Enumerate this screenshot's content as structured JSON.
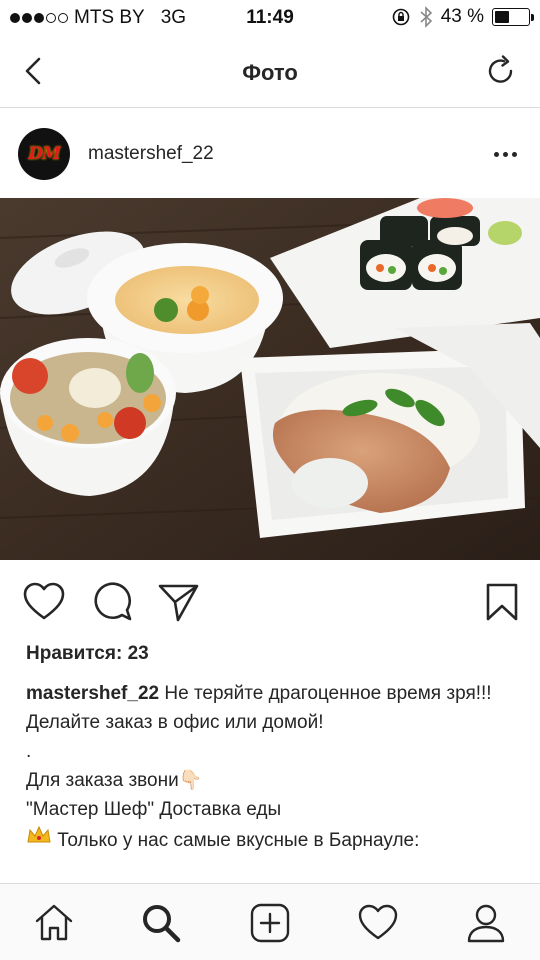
{
  "status_bar": {
    "carrier": "MTS BY",
    "network": "3G",
    "time": "11:49",
    "battery_text": "43 %",
    "battery_level": 0.43
  },
  "nav": {
    "title": "Фото"
  },
  "post": {
    "username": "mastershef_22",
    "avatar_text": "DM",
    "likes_text": "Нравится: 23",
    "caption": {
      "username": "mastershef_22",
      "line1": " Не теряйте драгоценное время зря!!!",
      "line2": "Делайте заказ в офис или домой!",
      "line3": ".",
      "line4": "Для заказа звони👇🏻",
      "line5": "\"Мастер Шеф\" Доставка еды",
      "line6": " Только у нас самые вкусные в Барнауле:"
    }
  },
  "icons": {
    "back": "chevron-left-icon",
    "refresh": "refresh-icon",
    "more": "more-horizontal-icon",
    "like": "heart-icon",
    "comment": "comment-icon",
    "share": "paper-plane-icon",
    "save": "bookmark-icon",
    "home": "home-icon",
    "search": "search-icon",
    "add": "add-post-icon",
    "activity": "heart-icon",
    "profile": "profile-icon"
  },
  "colors": {
    "text": "#262626",
    "divider": "#dbdbdb",
    "tabbar_bg": "#fafafa"
  }
}
